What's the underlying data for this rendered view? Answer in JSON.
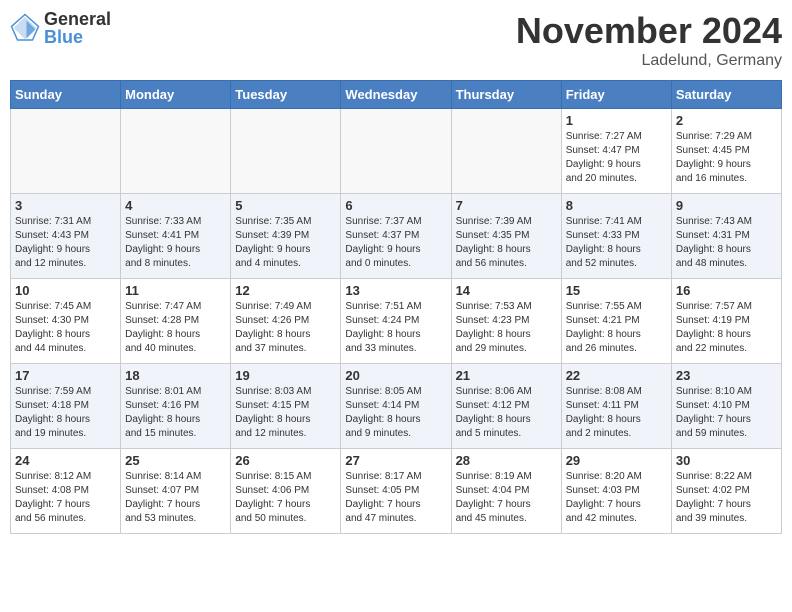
{
  "logo": {
    "general": "General",
    "blue": "Blue"
  },
  "title": "November 2024",
  "location": "Ladelund, Germany",
  "weekdays": [
    "Sunday",
    "Monday",
    "Tuesday",
    "Wednesday",
    "Thursday",
    "Friday",
    "Saturday"
  ],
  "weeks": [
    [
      {
        "day": "",
        "info": ""
      },
      {
        "day": "",
        "info": ""
      },
      {
        "day": "",
        "info": ""
      },
      {
        "day": "",
        "info": ""
      },
      {
        "day": "",
        "info": ""
      },
      {
        "day": "1",
        "info": "Sunrise: 7:27 AM\nSunset: 4:47 PM\nDaylight: 9 hours\nand 20 minutes."
      },
      {
        "day": "2",
        "info": "Sunrise: 7:29 AM\nSunset: 4:45 PM\nDaylight: 9 hours\nand 16 minutes."
      }
    ],
    [
      {
        "day": "3",
        "info": "Sunrise: 7:31 AM\nSunset: 4:43 PM\nDaylight: 9 hours\nand 12 minutes."
      },
      {
        "day": "4",
        "info": "Sunrise: 7:33 AM\nSunset: 4:41 PM\nDaylight: 9 hours\nand 8 minutes."
      },
      {
        "day": "5",
        "info": "Sunrise: 7:35 AM\nSunset: 4:39 PM\nDaylight: 9 hours\nand 4 minutes."
      },
      {
        "day": "6",
        "info": "Sunrise: 7:37 AM\nSunset: 4:37 PM\nDaylight: 9 hours\nand 0 minutes."
      },
      {
        "day": "7",
        "info": "Sunrise: 7:39 AM\nSunset: 4:35 PM\nDaylight: 8 hours\nand 56 minutes."
      },
      {
        "day": "8",
        "info": "Sunrise: 7:41 AM\nSunset: 4:33 PM\nDaylight: 8 hours\nand 52 minutes."
      },
      {
        "day": "9",
        "info": "Sunrise: 7:43 AM\nSunset: 4:31 PM\nDaylight: 8 hours\nand 48 minutes."
      }
    ],
    [
      {
        "day": "10",
        "info": "Sunrise: 7:45 AM\nSunset: 4:30 PM\nDaylight: 8 hours\nand 44 minutes."
      },
      {
        "day": "11",
        "info": "Sunrise: 7:47 AM\nSunset: 4:28 PM\nDaylight: 8 hours\nand 40 minutes."
      },
      {
        "day": "12",
        "info": "Sunrise: 7:49 AM\nSunset: 4:26 PM\nDaylight: 8 hours\nand 37 minutes."
      },
      {
        "day": "13",
        "info": "Sunrise: 7:51 AM\nSunset: 4:24 PM\nDaylight: 8 hours\nand 33 minutes."
      },
      {
        "day": "14",
        "info": "Sunrise: 7:53 AM\nSunset: 4:23 PM\nDaylight: 8 hours\nand 29 minutes."
      },
      {
        "day": "15",
        "info": "Sunrise: 7:55 AM\nSunset: 4:21 PM\nDaylight: 8 hours\nand 26 minutes."
      },
      {
        "day": "16",
        "info": "Sunrise: 7:57 AM\nSunset: 4:19 PM\nDaylight: 8 hours\nand 22 minutes."
      }
    ],
    [
      {
        "day": "17",
        "info": "Sunrise: 7:59 AM\nSunset: 4:18 PM\nDaylight: 8 hours\nand 19 minutes."
      },
      {
        "day": "18",
        "info": "Sunrise: 8:01 AM\nSunset: 4:16 PM\nDaylight: 8 hours\nand 15 minutes."
      },
      {
        "day": "19",
        "info": "Sunrise: 8:03 AM\nSunset: 4:15 PM\nDaylight: 8 hours\nand 12 minutes."
      },
      {
        "day": "20",
        "info": "Sunrise: 8:05 AM\nSunset: 4:14 PM\nDaylight: 8 hours\nand 9 minutes."
      },
      {
        "day": "21",
        "info": "Sunrise: 8:06 AM\nSunset: 4:12 PM\nDaylight: 8 hours\nand 5 minutes."
      },
      {
        "day": "22",
        "info": "Sunrise: 8:08 AM\nSunset: 4:11 PM\nDaylight: 8 hours\nand 2 minutes."
      },
      {
        "day": "23",
        "info": "Sunrise: 8:10 AM\nSunset: 4:10 PM\nDaylight: 7 hours\nand 59 minutes."
      }
    ],
    [
      {
        "day": "24",
        "info": "Sunrise: 8:12 AM\nSunset: 4:08 PM\nDaylight: 7 hours\nand 56 minutes."
      },
      {
        "day": "25",
        "info": "Sunrise: 8:14 AM\nSunset: 4:07 PM\nDaylight: 7 hours\nand 53 minutes."
      },
      {
        "day": "26",
        "info": "Sunrise: 8:15 AM\nSunset: 4:06 PM\nDaylight: 7 hours\nand 50 minutes."
      },
      {
        "day": "27",
        "info": "Sunrise: 8:17 AM\nSunset: 4:05 PM\nDaylight: 7 hours\nand 47 minutes."
      },
      {
        "day": "28",
        "info": "Sunrise: 8:19 AM\nSunset: 4:04 PM\nDaylight: 7 hours\nand 45 minutes."
      },
      {
        "day": "29",
        "info": "Sunrise: 8:20 AM\nSunset: 4:03 PM\nDaylight: 7 hours\nand 42 minutes."
      },
      {
        "day": "30",
        "info": "Sunrise: 8:22 AM\nSunset: 4:02 PM\nDaylight: 7 hours\nand 39 minutes."
      }
    ]
  ]
}
